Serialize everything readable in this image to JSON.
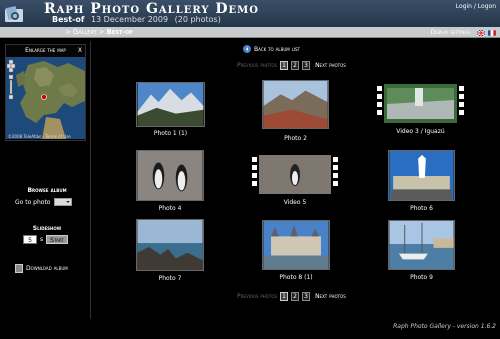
{
  "header": {
    "app_title": "Raph Photo Gallery Demo",
    "album_name": "Best-of",
    "album_date": "13 December 2009",
    "photo_count": "(20 photos)",
    "login_link": "Login / Logon"
  },
  "breadcrumb": {
    "separator": ">",
    "gallery": "Gallery",
    "current": "Best-of"
  },
  "display_settings": "Display settings",
  "sidebar": {
    "map_title": "Enlarge the map",
    "map_close": "X",
    "map_credit": "©2008 TeleAtlas - Terms of Use",
    "browse_title": "Browse album",
    "goto_label": "Go to photo",
    "slideshow_title": "Slideshow",
    "slideshow_interval": "5",
    "slideshow_unit": "s",
    "start_label": "Start",
    "download_label": "Download album"
  },
  "main": {
    "back_label": "Back to album list",
    "pager": {
      "prev_label": "Previous photos",
      "pages": [
        "1",
        "2",
        "3"
      ],
      "next_label": "Next photos"
    },
    "thumbnails": [
      {
        "caption": "Photo 1   (1)",
        "kind": "photo"
      },
      {
        "caption": "Photo 2",
        "kind": "photo"
      },
      {
        "caption": "Video 3 / Iguazú",
        "kind": "video"
      },
      {
        "caption": "Photo 4",
        "kind": "photo"
      },
      {
        "caption": "Video 5",
        "kind": "video"
      },
      {
        "caption": "Photo 6",
        "kind": "photo"
      },
      {
        "caption": "Photo 7",
        "kind": "photo"
      },
      {
        "caption": "Photo 8   (1)",
        "kind": "photo"
      },
      {
        "caption": "Photo 9",
        "kind": "photo"
      }
    ]
  },
  "footer": "Raph Photo Gallery - version 1.6.2",
  "colors": {
    "header": "#2f4359",
    "crumbbar": "#c8cbce",
    "background": "#000000",
    "accent": "#4a86c5"
  }
}
